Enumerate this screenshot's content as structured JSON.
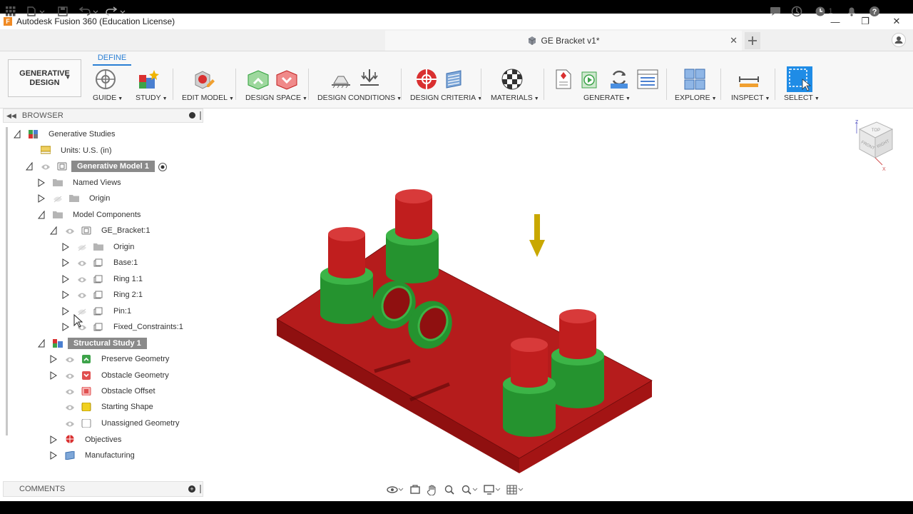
{
  "window": {
    "title": "Autodesk Fusion 360 (Education License)",
    "logo_letter": "F"
  },
  "document": {
    "tab_title": "GE Bracket v1*",
    "notification_count": "1"
  },
  "workspace": {
    "label_line1": "GENERATIVE",
    "label_line2": "DESIGN"
  },
  "ribbon": {
    "active_tab": "DEFINE",
    "groups": [
      {
        "label": "GUIDE"
      },
      {
        "label": "STUDY"
      },
      {
        "label": "EDIT MODEL"
      },
      {
        "label": "DESIGN SPACE"
      },
      {
        "label": "DESIGN CONDITIONS"
      },
      {
        "label": "DESIGN CRITERIA"
      },
      {
        "label": "MATERIALS"
      },
      {
        "label": "GENERATE"
      },
      {
        "label": "EXPLORE"
      },
      {
        "label": "INSPECT"
      },
      {
        "label": "SELECT"
      }
    ]
  },
  "browser": {
    "title": "BROWSER",
    "tree": [
      {
        "label": "Generative Studies"
      },
      {
        "label": "Units: U.S. (in)"
      },
      {
        "label": "Generative Model 1"
      },
      {
        "label": "Named Views"
      },
      {
        "label": "Origin"
      },
      {
        "label": "Model Components"
      },
      {
        "label": "GE_Bracket:1"
      },
      {
        "label": "Origin"
      },
      {
        "label": "Base:1"
      },
      {
        "label": "Ring 1:1"
      },
      {
        "label": "Ring 2:1"
      },
      {
        "label": "Pin:1"
      },
      {
        "label": "Fixed_Constraints:1"
      },
      {
        "label": "Structural Study 1"
      },
      {
        "label": "Preserve Geometry"
      },
      {
        "label": "Obstacle Geometry"
      },
      {
        "label": "Obstacle Offset"
      },
      {
        "label": "Starting Shape"
      },
      {
        "label": "Unassigned Geometry"
      },
      {
        "label": "Objectives"
      },
      {
        "label": "Manufacturing"
      }
    ]
  },
  "comments": {
    "title": "COMMENTS"
  },
  "viewcube": {
    "faces": [
      "TOP",
      "FRONT",
      "RIGHT"
    ],
    "axes": [
      "Z",
      "X"
    ]
  },
  "colors": {
    "accent": "#2a7fd4",
    "obstacle_red": "#b01818",
    "preserve_green": "#2fa03a",
    "load_arrow": "#c9a800"
  }
}
